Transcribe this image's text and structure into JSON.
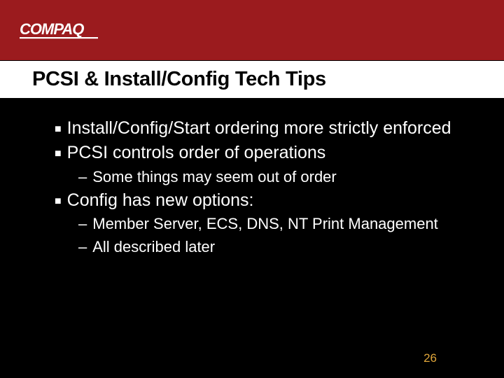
{
  "brand": "COMPAQ",
  "title": "PCSI & Install/Config Tech Tips",
  "bullets": {
    "b0": "Install/Config/Start ordering more strictly enforced",
    "b1": "PCSI controls order of operations",
    "b1_sub0": "Some things may seem out of order",
    "b2": "Config has new options:",
    "b2_sub0": "Member Server, ECS, DNS, NT Print Management",
    "b2_sub1": "All described later"
  },
  "page_number": "26"
}
